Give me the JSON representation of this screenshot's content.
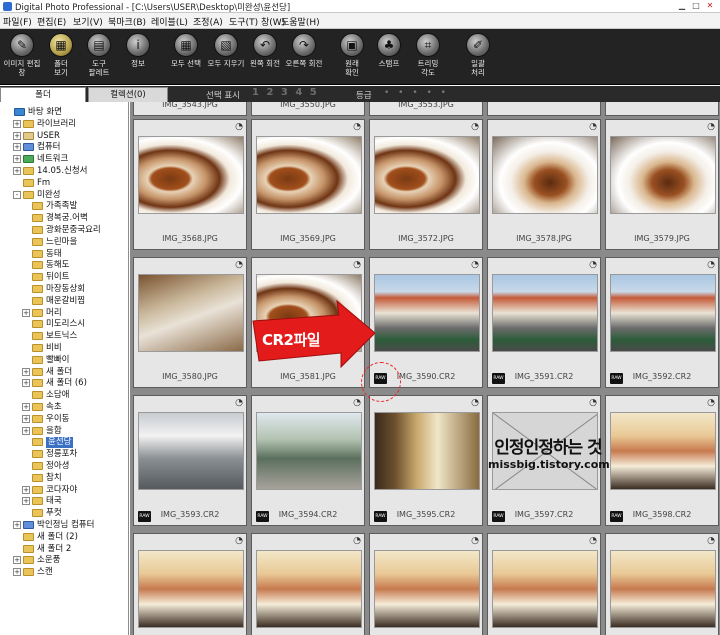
{
  "window": {
    "title": "Digital Photo Professional - [C:\\Users\\USER\\Desktop\\미완성\\윤선당]"
  },
  "menu": [
    "파일(F)",
    "편집(E)",
    "보기(V)",
    "북마크(B)",
    "레이블(L)",
    "조정(A)",
    "도구(T)",
    "창(W)",
    "도움말(H)"
  ],
  "toolbar": [
    {
      "label": "이미지 편집\n창",
      "icon": "edit-window-icon",
      "glyph": "✎"
    },
    {
      "label": "폴더\n보기",
      "icon": "folder-view-icon",
      "glyph": "▦",
      "active": true
    },
    {
      "label": "도구\n팔레트",
      "icon": "tool-palette-icon",
      "glyph": "▤"
    },
    {
      "label": "정보",
      "icon": "info-icon",
      "glyph": "i"
    },
    {
      "label": "모두 선택",
      "icon": "select-all-icon",
      "glyph": "▦"
    },
    {
      "label": "모두 지우기",
      "icon": "clear-all-icon",
      "glyph": "▧"
    },
    {
      "label": "왼쪽 회전",
      "icon": "rotate-left-icon",
      "glyph": "↶"
    },
    {
      "label": "오른쪽 회전",
      "icon": "rotate-right-icon",
      "glyph": "↷"
    },
    {
      "label": "원래\n확인",
      "icon": "check-original-icon",
      "glyph": "▣"
    },
    {
      "label": "스탬프",
      "icon": "stamp-icon",
      "glyph": "♣"
    },
    {
      "label": "트리밍\n각도",
      "icon": "trim-angle-icon",
      "glyph": "⌗"
    },
    {
      "label": "일괄\n처리",
      "icon": "batch-process-icon",
      "glyph": "✐"
    }
  ],
  "tabs": {
    "folder": "폴더",
    "collection": "컬렉션(0)"
  },
  "selection": {
    "label": "선택 표시",
    "numbers": "1 2 3 4 5",
    "rating_label": "등급",
    "rating_dots": "• • • • •"
  },
  "tree": [
    {
      "label": "바탕 화면",
      "icon": "desktop",
      "exp": "",
      "level": 0
    },
    {
      "label": "라이브러리",
      "icon": "folder",
      "exp": "+",
      "level": 1
    },
    {
      "label": "USER",
      "icon": "user",
      "exp": "+",
      "level": 1
    },
    {
      "label": "컴퓨터",
      "icon": "comp",
      "exp": "+",
      "level": 1
    },
    {
      "label": "네트워크",
      "icon": "net",
      "exp": "+",
      "level": 1
    },
    {
      "label": "14.05.신청서",
      "icon": "folder",
      "exp": "+",
      "level": 1
    },
    {
      "label": "Fm",
      "icon": "folder",
      "exp": "",
      "level": 1
    },
    {
      "label": "미완성",
      "icon": "folder",
      "exp": "-",
      "level": 1
    },
    {
      "label": "가족족발",
      "icon": "folder",
      "exp": "",
      "level": 2
    },
    {
      "label": "경복궁.어벽",
      "icon": "folder",
      "exp": "",
      "level": 2
    },
    {
      "label": "광화문중국요리",
      "icon": "folder",
      "exp": "",
      "level": 2
    },
    {
      "label": "느린마을",
      "icon": "folder",
      "exp": "",
      "level": 2
    },
    {
      "label": "동태",
      "icon": "folder",
      "exp": "",
      "level": 2
    },
    {
      "label": "동해도",
      "icon": "folder",
      "exp": "",
      "level": 2
    },
    {
      "label": "뒤이트",
      "icon": "folder",
      "exp": "",
      "level": 2
    },
    {
      "label": "마장동상회",
      "icon": "folder",
      "exp": "",
      "level": 2
    },
    {
      "label": "매운갈비찜",
      "icon": "folder",
      "exp": "",
      "level": 2
    },
    {
      "label": "머리",
      "icon": "folder",
      "exp": "+",
      "level": 2
    },
    {
      "label": "미도리스시",
      "icon": "folder",
      "exp": "",
      "level": 2
    },
    {
      "label": "보트닉스",
      "icon": "folder",
      "exp": "",
      "level": 2
    },
    {
      "label": "비비",
      "icon": "folder",
      "exp": "",
      "level": 2
    },
    {
      "label": "빨빠이",
      "icon": "folder",
      "exp": "",
      "level": 2
    },
    {
      "label": "새 폴더",
      "icon": "folder",
      "exp": "+",
      "level": 2
    },
    {
      "label": "새 폴더 (6)",
      "icon": "folder",
      "exp": "+",
      "level": 2
    },
    {
      "label": "소담애",
      "icon": "folder",
      "exp": "",
      "level": 2
    },
    {
      "label": "속초",
      "icon": "folder",
      "exp": "+",
      "level": 2
    },
    {
      "label": "우이동",
      "icon": "folder",
      "exp": "+",
      "level": 2
    },
    {
      "label": "을합",
      "icon": "folder",
      "exp": "+",
      "level": 2
    },
    {
      "label": "윤선당",
      "icon": "folder",
      "exp": "",
      "level": 2,
      "selected": true
    },
    {
      "label": "정릉포차",
      "icon": "folder",
      "exp": "",
      "level": 2
    },
    {
      "label": "정아셩",
      "icon": "folder",
      "exp": "",
      "level": 2
    },
    {
      "label": "참치",
      "icon": "folder",
      "exp": "",
      "level": 2
    },
    {
      "label": "코다자야",
      "icon": "folder",
      "exp": "+",
      "level": 2
    },
    {
      "label": "태국",
      "icon": "folder",
      "exp": "+",
      "level": 2
    },
    {
      "label": "푸컷",
      "icon": "folder",
      "exp": "",
      "level": 2
    },
    {
      "label": "박인정님 컴퓨터",
      "icon": "comp",
      "exp": "+",
      "level": 1
    },
    {
      "label": "새 폴더 (2)",
      "icon": "folder",
      "exp": "",
      "level": 1
    },
    {
      "label": "새 폴더 2",
      "icon": "folder",
      "exp": "",
      "level": 1
    },
    {
      "label": "소운풍",
      "icon": "folder",
      "exp": "+",
      "level": 1
    },
    {
      "label": "스캔",
      "icon": "folder",
      "exp": "+",
      "level": 1
    }
  ],
  "top_partial_names": [
    "IMG_3543.JPG",
    "IMG_3550.JPG",
    "IMG_3553.JPG",
    "",
    ""
  ],
  "thumbnails": [
    {
      "name": "IMG_3568.JPG",
      "style": "food",
      "raw": false
    },
    {
      "name": "IMG_3569.JPG",
      "style": "food",
      "raw": false
    },
    {
      "name": "IMG_3572.JPG",
      "style": "food",
      "raw": false
    },
    {
      "name": "IMG_3578.JPG",
      "style": "food2",
      "raw": false
    },
    {
      "name": "IMG_3579.JPG",
      "style": "food2",
      "raw": false
    },
    {
      "name": "IMG_3580.JPG",
      "style": "table",
      "raw": false
    },
    {
      "name": "IMG_3581.JPG",
      "style": "food",
      "raw": false
    },
    {
      "name": "IMG_3590.CR2",
      "style": "street",
      "raw": true
    },
    {
      "name": "IMG_3591.CR2",
      "style": "street",
      "raw": true
    },
    {
      "name": "IMG_3592.CR2",
      "style": "street",
      "raw": true
    },
    {
      "name": "IMG_3593.CR2",
      "style": "interior",
      "raw": true
    },
    {
      "name": "IMG_3594.CR2",
      "style": "outdoor",
      "raw": true
    },
    {
      "name": "IMG_3595.CR2",
      "style": "wood",
      "raw": true
    },
    {
      "name": "IMG_3597.CR2",
      "style": "noimg",
      "raw": true
    },
    {
      "name": "IMG_3598.CR2",
      "style": "menu",
      "raw": true
    },
    {
      "name": "",
      "style": "menu",
      "raw": false
    },
    {
      "name": "",
      "style": "menu",
      "raw": false
    },
    {
      "name": "",
      "style": "menu",
      "raw": false
    },
    {
      "name": "",
      "style": "menu",
      "raw": false
    },
    {
      "name": "",
      "style": "menu",
      "raw": false
    }
  ],
  "raw_badge": "RAW",
  "rotate_glyph": "◔",
  "annotation": {
    "callout": "CR2파일",
    "watermark_line1": "인정인정하는 것",
    "watermark_line2": "missbig.tistory.com"
  },
  "colors": {
    "toolbar_bg": "#232323",
    "selection": "#3a71c4",
    "callout": "#e31b1b",
    "grid_bg": "#8a8a8a"
  }
}
